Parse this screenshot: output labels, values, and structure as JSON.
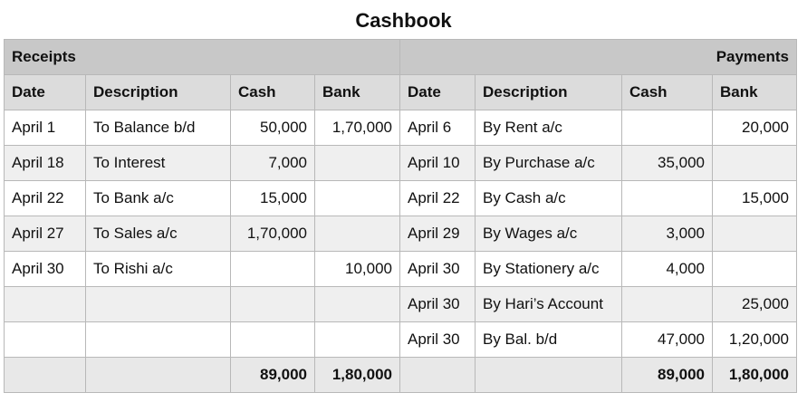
{
  "title": "Cashbook",
  "banner": {
    "left": "Receipts",
    "right": "Payments"
  },
  "headers": [
    "Date",
    "Description",
    "Cash",
    "Bank",
    "Date",
    "Description",
    "Cash",
    "Bank"
  ],
  "rows": [
    [
      "April 1",
      "To Balance b/d",
      "50,000",
      "1,70,000",
      "April 6",
      "By Rent a/c",
      "",
      "20,000"
    ],
    [
      "April 18",
      "To Interest",
      "7,000",
      "",
      "April 10",
      "By Purchase a/c",
      "35,000",
      ""
    ],
    [
      "April 22",
      "To Bank a/c",
      "15,000",
      "",
      "April 22",
      "By Cash a/c",
      "",
      "15,000"
    ],
    [
      "April 27",
      "To Sales a/c",
      "1,70,000",
      "",
      "April 29",
      "By Wages a/c",
      "3,000",
      ""
    ],
    [
      "April 30",
      "To Rishi a/c",
      "",
      "10,000",
      "April 30",
      "By Stationery a/c",
      "4,000",
      ""
    ],
    [
      "",
      "",
      "",
      "",
      "April 30",
      "By Hari’s Account",
      "",
      "25,000"
    ],
    [
      "",
      "",
      "",
      "",
      "April 30",
      "By Bal. b/d",
      "47,000",
      "1,20,000"
    ]
  ],
  "totals": [
    "",
    "",
    "89,000",
    "1,80,000",
    "",
    "",
    "89,000",
    "1,80,000"
  ]
}
